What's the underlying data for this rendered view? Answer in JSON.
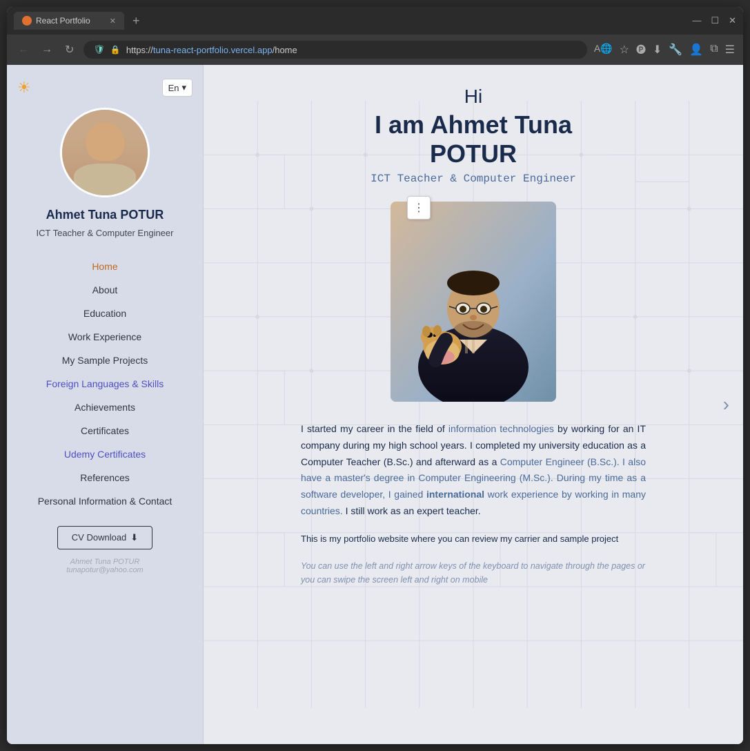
{
  "browser": {
    "tab_label": "React Portfolio",
    "tab_favicon": "react-favicon",
    "url_display": "https://tuna-react-portfolio.vercel.app/home",
    "url_highlight": "tuna-react-portfolio.vercel.app",
    "new_tab_label": "+"
  },
  "sidebar": {
    "lang_selector": "En",
    "person_name": "Ahmet Tuna POTUR",
    "person_title": "ICT Teacher & Computer Engineer",
    "nav_items": [
      {
        "label": "Home",
        "active": true,
        "style": "active"
      },
      {
        "label": "About",
        "active": false,
        "style": "normal"
      },
      {
        "label": "Education",
        "active": false,
        "style": "normal"
      },
      {
        "label": "Work Experience",
        "active": false,
        "style": "normal"
      },
      {
        "label": "My Sample Projects",
        "active": false,
        "style": "normal"
      },
      {
        "label": "Foreign Languages & Skills",
        "active": false,
        "style": "purple"
      },
      {
        "label": "Achievements",
        "active": false,
        "style": "normal"
      },
      {
        "label": "Certificates",
        "active": false,
        "style": "normal"
      },
      {
        "label": "Udemy Certificates",
        "active": false,
        "style": "purple"
      },
      {
        "label": "References",
        "active": false,
        "style": "normal"
      },
      {
        "label": "Personal Information & Contact",
        "active": false,
        "style": "normal"
      }
    ],
    "cv_download_label": "CV Download",
    "footer_name": "Ahmet Tuna POTUR",
    "footer_email": "tunapotur@yahoo.com"
  },
  "main": {
    "hi_text": "Hi",
    "name_line1": "I am Ahmet Tuna",
    "name_line2": "POTUR",
    "subtitle": "ICT Teacher & Computer Engineer",
    "bio_paragraph": "I started my career in the field of information technologies by working for an IT company during my high school years. I completed my university education as a Computer Teacher (B.Sc.) and afterward as a Computer Engineer (B.Sc.). I also have a master's degree in Computer Engineering (M.Sc.). During my time as a software developer, I gained international work experience by working in many countries. I still work as an expert teacher.",
    "portfolio_note": "This is my portfolio website where you can review my carrier and sample project",
    "keyboard_note": "You can use the left and right arrow keys of the keyboard to navigate through the pages or you can swipe the screen left and right on mobile",
    "next_arrow": "›"
  },
  "three_dot_menu": "⋮",
  "icons": {
    "sun": "☀",
    "chevron_down": "▾",
    "download": "↓",
    "back": "←",
    "forward": "→",
    "refresh": "↺",
    "shield": "🛡",
    "lock": "🔒",
    "translate": "A",
    "star": "☆",
    "pocket": "P",
    "download_btn": "⬇",
    "wrench": "🔧",
    "profile": "👤",
    "extensions": "⧉",
    "menu": "☰",
    "next": "›"
  }
}
